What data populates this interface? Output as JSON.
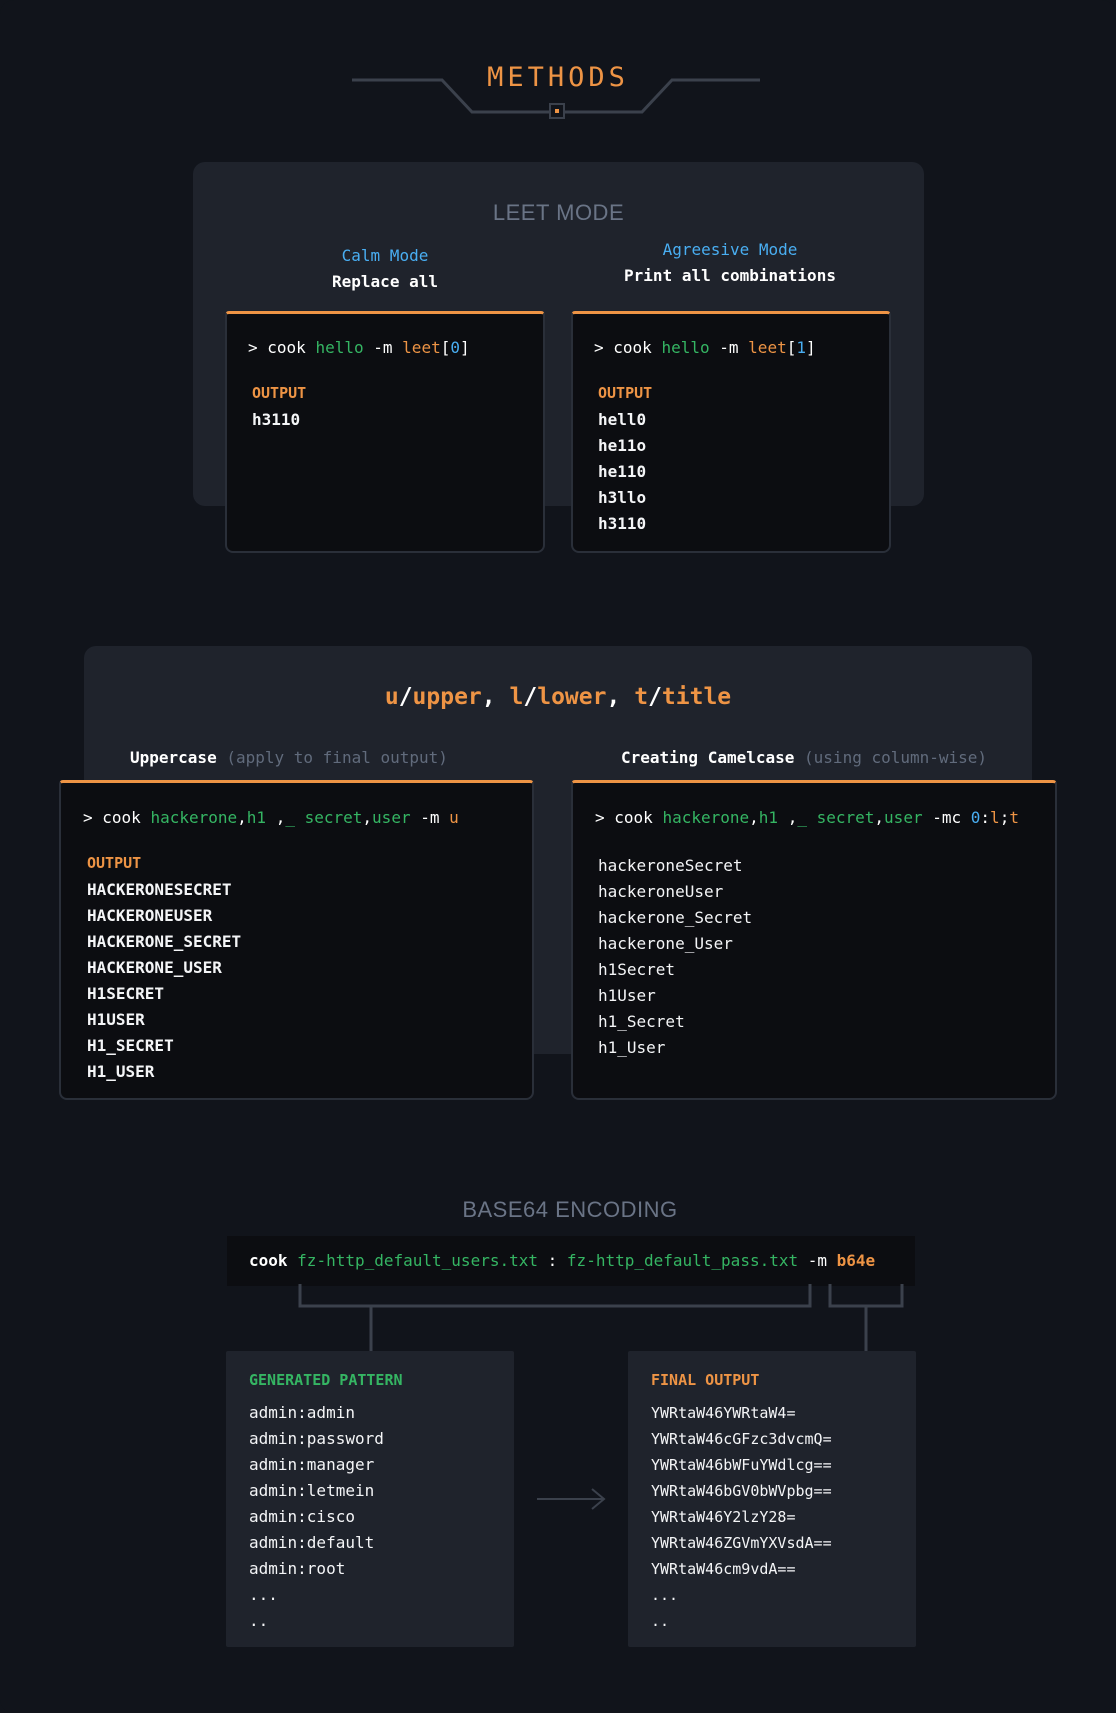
{
  "header": {
    "title": "METHODS"
  },
  "leet": {
    "title": "LEET MODE",
    "calm": {
      "mode": "Calm Mode",
      "desc": "Replace all",
      "cmd": {
        "prompt": ">",
        "word": "cook",
        "arg": "hello",
        "flag": "-m",
        "method": "leet",
        "lb": "[",
        "idx": "0",
        "rb": "]"
      },
      "output_label": "OUTPUT",
      "output": "h3110"
    },
    "aggressive": {
      "mode": "Agreesive Mode",
      "desc": "Print all combinations",
      "cmd": {
        "prompt": ">",
        "word": "cook",
        "arg": "hello",
        "flag": "-m",
        "method": "leet",
        "lb": "[",
        "idx": "1",
        "rb": "]"
      },
      "output_label": "OUTPUT",
      "output": "hell0\nhe11o\nhe110\nh3llo\nh3110"
    }
  },
  "case": {
    "title": {
      "u": "u",
      "upper": "upper",
      "l": "l",
      "lower": "lower",
      "t": "t",
      "titlew": "title",
      "slash": "/",
      "comma": ","
    },
    "upper": {
      "label": "Uppercase",
      "note": "(apply to final output)",
      "cmd": {
        "prompt": ">",
        "word": "cook",
        "a1": "hackerone",
        "c1": ",",
        "a2": "h1",
        "sp": " ,",
        "a3": "_",
        "a4": "secret",
        "c2": ",",
        "a5": "user",
        "flag": "-m",
        "method": "u"
      },
      "output_label": "OUTPUT",
      "output": "HACKERONESECRET\nHACKERONEUSER\nHACKERONE_SECRET\nHACKERONE_USER\nH1SECRET\nH1USER\nH1_SECRET\nH1_USER"
    },
    "camel": {
      "label": "Creating Camelcase",
      "note": "(using column-wise)",
      "cmd": {
        "prompt": ">",
        "word": "cook",
        "a1": "hackerone",
        "c1": ",",
        "a2": "h1",
        "sp": " ,",
        "a3": "_",
        "a4": "secret",
        "c2": ",",
        "a5": "user",
        "flag": "-mc",
        "n0": "0",
        "colon": ":",
        "l": "l",
        "semi": ";",
        "t": "t"
      },
      "output": "hackeroneSecret\nhackeroneUser\nhackerone_Secret\nhackerone_User\nh1Secret\nh1User\nh1_Secret\nh1_User"
    }
  },
  "base64": {
    "title": "BASE64 ENCODING",
    "cmd": {
      "word": "cook",
      "file1": "fz-http_default_users.txt",
      "colon": ":",
      "file2": "fz-http_default_pass.txt",
      "flag": "-m",
      "method": "b64e"
    },
    "generated_label": "GENERATED PATTERN",
    "generated": "admin:admin\nadmin:password\nadmin:manager\nadmin:letmein\nadmin:cisco\nadmin:default\nadmin:root\n...\n..",
    "final_label": "FINAL OUTPUT",
    "final": "YWRtaW46YWRtaW4=\nYWRtaW46cGFzc3dvcmQ=\nYWRtaW46bWFuYWdlcg==\nYWRtaW46bGV0bWVpbg==\nYWRtaW46Y2lzY28=\nYWRtaW46ZGVmYXVsdA==\nYWRtaW46cm9vdA==\n...\n.."
  },
  "colors": {
    "accent": "#ee9445",
    "green": "#35b563",
    "blue": "#49aef2",
    "panel": "#1f232c",
    "bg": "#11141b"
  }
}
